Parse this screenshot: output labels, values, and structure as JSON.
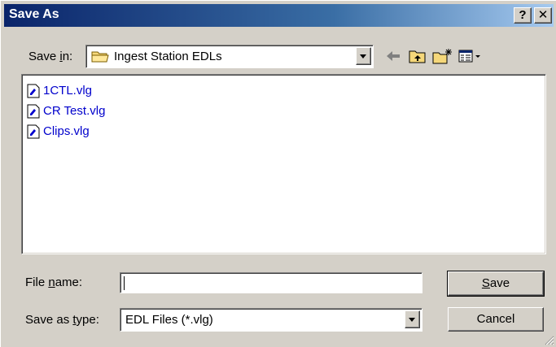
{
  "window": {
    "title": "Save As",
    "help_label": "?",
    "close_label": "✕"
  },
  "save_in": {
    "label_pre": "Save ",
    "label_accel": "i",
    "label_post": "n:",
    "value": "Ingest Station EDLs",
    "folder_icon": "folder-icon"
  },
  "toolbar": {
    "icons": [
      "back-arrow-icon",
      "up-one-level-icon",
      "create-new-folder-icon",
      "view-menu-icon"
    ]
  },
  "files": [
    {
      "name": "1CTL.vlg",
      "icon": "file-icon"
    },
    {
      "name": "CR Test.vlg",
      "icon": "file-icon"
    },
    {
      "name": "Clips.vlg",
      "icon": "file-icon"
    }
  ],
  "file_name": {
    "label_pre": "File ",
    "label_accel": "n",
    "label_post": "ame:",
    "value": ""
  },
  "save_as_type": {
    "label_pre": "Save as ",
    "label_accel": "t",
    "label_post": "ype:",
    "value": "EDL Files (*.vlg)"
  },
  "buttons": {
    "save_accel": "S",
    "save_rest": "ave",
    "cancel": "Cancel"
  },
  "colors": {
    "title_start": "#0a246a",
    "title_end": "#a6caf0",
    "face": "#d4d0c8",
    "link": "#0000cc"
  }
}
